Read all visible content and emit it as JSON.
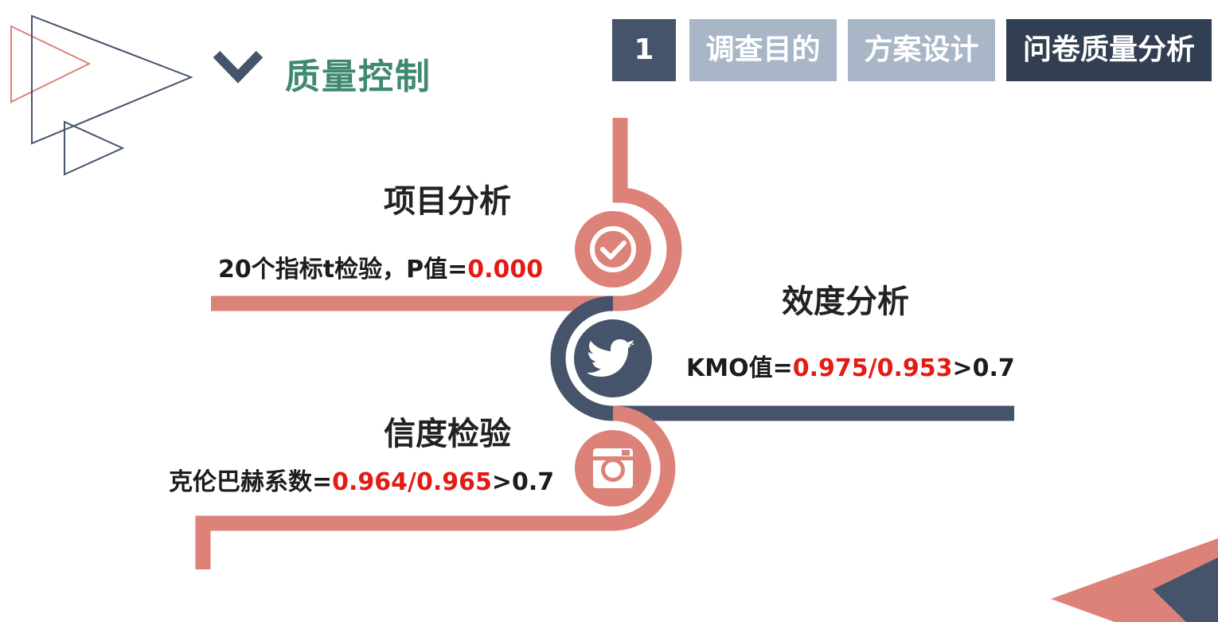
{
  "header": {
    "chevron_icon": "chevron-down-icon",
    "title": "质量控制"
  },
  "nav": {
    "number": "1",
    "tabs": [
      {
        "label": "调查目的",
        "active": false
      },
      {
        "label": "方案设计",
        "active": false
      },
      {
        "label": "问卷质量分析",
        "active": true
      }
    ]
  },
  "sections": [
    {
      "icon": "check-circle-icon",
      "heading": "项目分析",
      "stat_prefix": "20个指标t检验，P值=",
      "stat_value": "0.000",
      "stat_suffix": ""
    },
    {
      "icon": "twitter-bird-icon",
      "heading": "效度分析",
      "stat_prefix": "KMO值=",
      "stat_value": "0.975/0.953",
      "stat_suffix": ">0.7"
    },
    {
      "icon": "instagram-camera-icon",
      "heading": "信度检验",
      "stat_prefix": "克伦巴赫系数=",
      "stat_value": "0.964/0.965",
      "stat_suffix": ">0.7"
    }
  ],
  "colors": {
    "salmon": "#dc8278",
    "navy": "#45546b",
    "green_title": "#3f8a6e",
    "highlight_red": "#e41b14",
    "tab_inactive": "#a8b6c8",
    "tab_active": "#323e51"
  }
}
